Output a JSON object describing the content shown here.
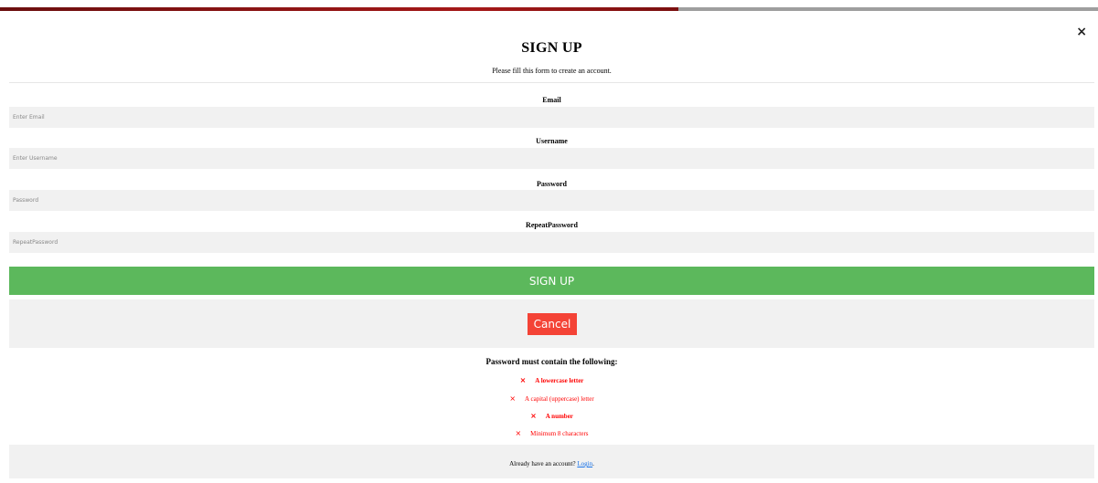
{
  "modal": {
    "close_label": "×",
    "title": "SIGN UP",
    "subtitle": "Please fill this form to create an account."
  },
  "fields": {
    "email": {
      "label": "Email",
      "placeholder": "Enter Email",
      "value": ""
    },
    "username": {
      "label": "Username",
      "placeholder": "Enter Username",
      "value": ""
    },
    "password": {
      "label": "Password",
      "placeholder": "Password",
      "value": ""
    },
    "repeat_password": {
      "label": "RepeatPassword",
      "placeholder": "RepeatPassword",
      "value": ""
    }
  },
  "buttons": {
    "signup_label": "SIGN UP",
    "cancel_label": "Cancel"
  },
  "password_rules": {
    "title": "Password must contain the following:",
    "mark": "×",
    "items": [
      {
        "text": "A lowercase letter",
        "bold": true
      },
      {
        "text": "A capital (uppercase) letter",
        "bold": false
      },
      {
        "text": "A number",
        "bold": true
      },
      {
        "text": "Minimum 8 characters",
        "bold": false
      }
    ]
  },
  "footer": {
    "text": "Already have an account?",
    "link_label": "Login",
    "suffix": "."
  },
  "colors": {
    "signup_button": "#5cb85c",
    "cancel_button": "#f44336",
    "rule_text": "#ff0000",
    "input_background": "#f1f1f1",
    "link": "#1a73e8"
  },
  "icons": {
    "close": "close-icon",
    "rule_mark": "cross-icon"
  }
}
